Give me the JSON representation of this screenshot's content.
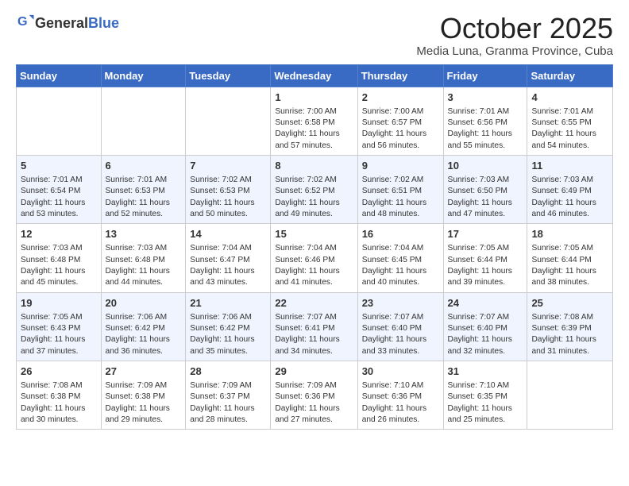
{
  "header": {
    "logo_general": "General",
    "logo_blue": "Blue",
    "month": "October 2025",
    "location": "Media Luna, Granma Province, Cuba"
  },
  "days_of_week": [
    "Sunday",
    "Monday",
    "Tuesday",
    "Wednesday",
    "Thursday",
    "Friday",
    "Saturday"
  ],
  "weeks": [
    [
      {
        "day": "",
        "content": ""
      },
      {
        "day": "",
        "content": ""
      },
      {
        "day": "",
        "content": ""
      },
      {
        "day": "1",
        "content": "Sunrise: 7:00 AM\nSunset: 6:58 PM\nDaylight: 11 hours\nand 57 minutes."
      },
      {
        "day": "2",
        "content": "Sunrise: 7:00 AM\nSunset: 6:57 PM\nDaylight: 11 hours\nand 56 minutes."
      },
      {
        "day": "3",
        "content": "Sunrise: 7:01 AM\nSunset: 6:56 PM\nDaylight: 11 hours\nand 55 minutes."
      },
      {
        "day": "4",
        "content": "Sunrise: 7:01 AM\nSunset: 6:55 PM\nDaylight: 11 hours\nand 54 minutes."
      }
    ],
    [
      {
        "day": "5",
        "content": "Sunrise: 7:01 AM\nSunset: 6:54 PM\nDaylight: 11 hours\nand 53 minutes."
      },
      {
        "day": "6",
        "content": "Sunrise: 7:01 AM\nSunset: 6:53 PM\nDaylight: 11 hours\nand 52 minutes."
      },
      {
        "day": "7",
        "content": "Sunrise: 7:02 AM\nSunset: 6:53 PM\nDaylight: 11 hours\nand 50 minutes."
      },
      {
        "day": "8",
        "content": "Sunrise: 7:02 AM\nSunset: 6:52 PM\nDaylight: 11 hours\nand 49 minutes."
      },
      {
        "day": "9",
        "content": "Sunrise: 7:02 AM\nSunset: 6:51 PM\nDaylight: 11 hours\nand 48 minutes."
      },
      {
        "day": "10",
        "content": "Sunrise: 7:03 AM\nSunset: 6:50 PM\nDaylight: 11 hours\nand 47 minutes."
      },
      {
        "day": "11",
        "content": "Sunrise: 7:03 AM\nSunset: 6:49 PM\nDaylight: 11 hours\nand 46 minutes."
      }
    ],
    [
      {
        "day": "12",
        "content": "Sunrise: 7:03 AM\nSunset: 6:48 PM\nDaylight: 11 hours\nand 45 minutes."
      },
      {
        "day": "13",
        "content": "Sunrise: 7:03 AM\nSunset: 6:48 PM\nDaylight: 11 hours\nand 44 minutes."
      },
      {
        "day": "14",
        "content": "Sunrise: 7:04 AM\nSunset: 6:47 PM\nDaylight: 11 hours\nand 43 minutes."
      },
      {
        "day": "15",
        "content": "Sunrise: 7:04 AM\nSunset: 6:46 PM\nDaylight: 11 hours\nand 41 minutes."
      },
      {
        "day": "16",
        "content": "Sunrise: 7:04 AM\nSunset: 6:45 PM\nDaylight: 11 hours\nand 40 minutes."
      },
      {
        "day": "17",
        "content": "Sunrise: 7:05 AM\nSunset: 6:44 PM\nDaylight: 11 hours\nand 39 minutes."
      },
      {
        "day": "18",
        "content": "Sunrise: 7:05 AM\nSunset: 6:44 PM\nDaylight: 11 hours\nand 38 minutes."
      }
    ],
    [
      {
        "day": "19",
        "content": "Sunrise: 7:05 AM\nSunset: 6:43 PM\nDaylight: 11 hours\nand 37 minutes."
      },
      {
        "day": "20",
        "content": "Sunrise: 7:06 AM\nSunset: 6:42 PM\nDaylight: 11 hours\nand 36 minutes."
      },
      {
        "day": "21",
        "content": "Sunrise: 7:06 AM\nSunset: 6:42 PM\nDaylight: 11 hours\nand 35 minutes."
      },
      {
        "day": "22",
        "content": "Sunrise: 7:07 AM\nSunset: 6:41 PM\nDaylight: 11 hours\nand 34 minutes."
      },
      {
        "day": "23",
        "content": "Sunrise: 7:07 AM\nSunset: 6:40 PM\nDaylight: 11 hours\nand 33 minutes."
      },
      {
        "day": "24",
        "content": "Sunrise: 7:07 AM\nSunset: 6:40 PM\nDaylight: 11 hours\nand 32 minutes."
      },
      {
        "day": "25",
        "content": "Sunrise: 7:08 AM\nSunset: 6:39 PM\nDaylight: 11 hours\nand 31 minutes."
      }
    ],
    [
      {
        "day": "26",
        "content": "Sunrise: 7:08 AM\nSunset: 6:38 PM\nDaylight: 11 hours\nand 30 minutes."
      },
      {
        "day": "27",
        "content": "Sunrise: 7:09 AM\nSunset: 6:38 PM\nDaylight: 11 hours\nand 29 minutes."
      },
      {
        "day": "28",
        "content": "Sunrise: 7:09 AM\nSunset: 6:37 PM\nDaylight: 11 hours\nand 28 minutes."
      },
      {
        "day": "29",
        "content": "Sunrise: 7:09 AM\nSunset: 6:36 PM\nDaylight: 11 hours\nand 27 minutes."
      },
      {
        "day": "30",
        "content": "Sunrise: 7:10 AM\nSunset: 6:36 PM\nDaylight: 11 hours\nand 26 minutes."
      },
      {
        "day": "31",
        "content": "Sunrise: 7:10 AM\nSunset: 6:35 PM\nDaylight: 11 hours\nand 25 minutes."
      },
      {
        "day": "",
        "content": ""
      }
    ]
  ]
}
